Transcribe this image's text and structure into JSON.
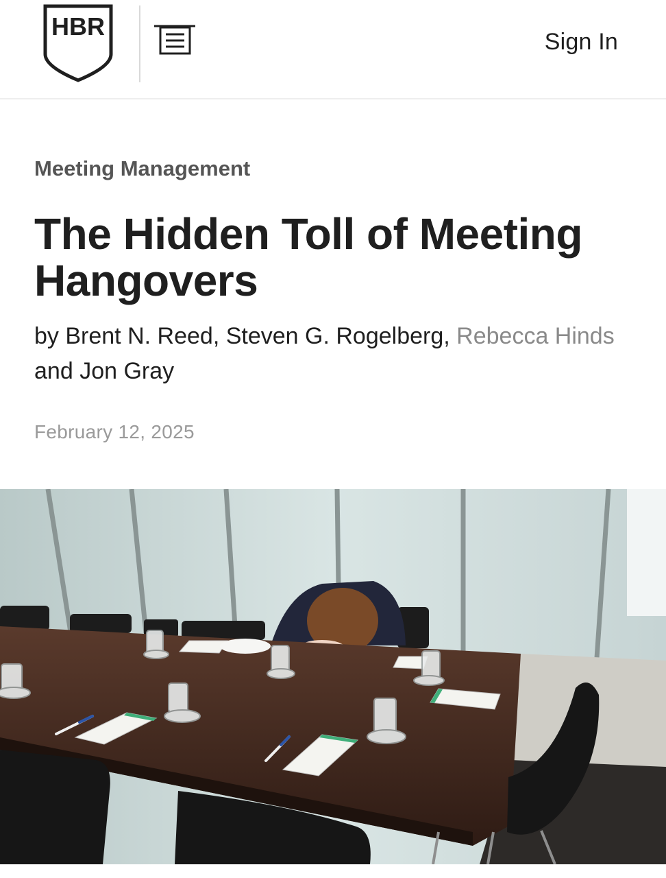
{
  "header": {
    "logo_text": "HBR",
    "menu_icon": "menu-list-icon",
    "signin_label": "Sign In"
  },
  "article": {
    "topic": "Meeting Management",
    "title": "The Hidden Toll of Meeting Hangovers",
    "byline": {
      "prefix": "by ",
      "author1": "Brent N. Reed",
      "sep1": ", ",
      "author2": "Steven G. Rogelberg",
      "sep2": ", ",
      "author3": "Rebecca Hinds",
      "sep3": " and ",
      "author4": "Jon Gray"
    },
    "date": "February 12, 2025"
  },
  "hero": {
    "description_icon": "meeting-room-photo"
  }
}
